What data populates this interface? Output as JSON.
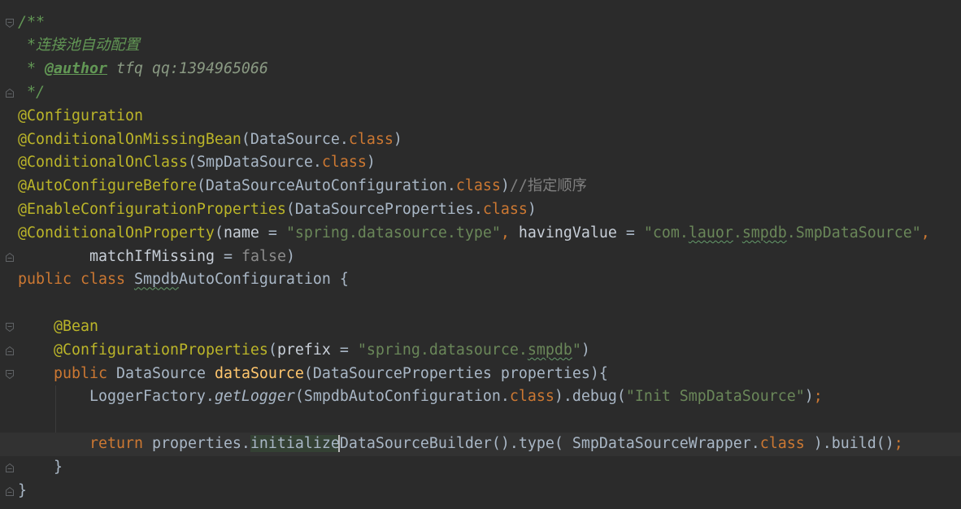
{
  "theme": {
    "background": "#2b2b2b",
    "text": "#a9b7c6",
    "keyword": "#cc7832",
    "annotation": "#bbb529",
    "string": "#6a8759",
    "doc_comment": "#629755",
    "doc_tag_value": "#8a9a83",
    "line_comment": "#808080",
    "named_param": "#c8cfd8",
    "method_declaration": "#ffc66d",
    "muted": "#8c8c8c",
    "typo_underline": "#659c6b",
    "current_line": "#323232",
    "usage_highlight": "#344134",
    "caret": "#bbbbbb",
    "gutter_icon": "#606366"
  },
  "editor": {
    "lines": [
      {
        "fold_icon": "fold-start-icon",
        "tokens": [
          {
            "t": "/**",
            "k": "doc"
          }
        ]
      },
      {
        "tokens": [
          {
            "t": " *连接池自动配置",
            "k": "doc"
          }
        ]
      },
      {
        "tokens": [
          {
            "t": " * ",
            "k": "doc"
          },
          {
            "t": "@author",
            "k": "doctag"
          },
          {
            "t": " tfq qq:1394965066",
            "k": "docval"
          }
        ]
      },
      {
        "fold_icon": "fold-end-icon",
        "tokens": [
          {
            "t": " */",
            "k": "doc"
          }
        ]
      },
      {
        "tokens": [
          {
            "t": "@Configuration",
            "k": "ann"
          }
        ]
      },
      {
        "tokens": [
          {
            "t": "@ConditionalOnMissingBean",
            "k": "ann"
          },
          {
            "t": "(DataSource.",
            "k": "plain"
          },
          {
            "t": "class",
            "k": "kw"
          },
          {
            "t": ")",
            "k": "plain"
          }
        ]
      },
      {
        "tokens": [
          {
            "t": "@ConditionalOnClass",
            "k": "ann"
          },
          {
            "t": "(SmpDataSource.",
            "k": "plain"
          },
          {
            "t": "class",
            "k": "kw"
          },
          {
            "t": ")",
            "k": "plain"
          }
        ]
      },
      {
        "tokens": [
          {
            "t": "@AutoConfigureBefore",
            "k": "ann"
          },
          {
            "t": "(DataSourceAutoConfiguration.",
            "k": "plain"
          },
          {
            "t": "class",
            "k": "kw"
          },
          {
            "t": ")",
            "k": "plain"
          },
          {
            "t": "//指定顺序",
            "k": "cmt"
          }
        ]
      },
      {
        "tokens": [
          {
            "t": "@EnableConfigurationProperties",
            "k": "ann"
          },
          {
            "t": "(DataSourceProperties.",
            "k": "plain"
          },
          {
            "t": "class",
            "k": "kw"
          },
          {
            "t": ")",
            "k": "plain"
          }
        ]
      },
      {
        "tokens": [
          {
            "t": "@ConditionalOnProperty",
            "k": "ann"
          },
          {
            "t": "(",
            "k": "plain"
          },
          {
            "t": "name",
            "k": "param"
          },
          {
            "t": " = ",
            "k": "plain"
          },
          {
            "t": "\"spring.datasource.type\"",
            "k": "str"
          },
          {
            "t": ",",
            "k": "kw"
          },
          {
            "t": " ",
            "k": "plain"
          },
          {
            "t": "havingValue",
            "k": "param"
          },
          {
            "t": " = ",
            "k": "plain"
          },
          {
            "t": "\"com.",
            "k": "str"
          },
          {
            "t": "lauor",
            "k": "typo-str"
          },
          {
            "t": ".",
            "k": "str"
          },
          {
            "t": "smpdb",
            "k": "typo-str"
          },
          {
            "t": ".SmpDataSource\"",
            "k": "str"
          },
          {
            "t": ",",
            "k": "kw"
          }
        ]
      },
      {
        "fold_icon": "fold-end-icon",
        "tokens": [
          {
            "t": "        ",
            "k": "plain"
          },
          {
            "t": "matchIfMissing",
            "k": "param"
          },
          {
            "t": " = ",
            "k": "plain"
          },
          {
            "t": "false",
            "k": "gray"
          },
          {
            "t": ")",
            "k": "plain"
          }
        ]
      },
      {
        "tokens": [
          {
            "t": "public",
            "k": "kw"
          },
          {
            "t": " ",
            "k": "plain"
          },
          {
            "t": "class",
            "k": "kw"
          },
          {
            "t": " ",
            "k": "plain"
          },
          {
            "t": "Smpdb",
            "k": "typo"
          },
          {
            "t": "AutoConfiguration {",
            "k": "plain"
          }
        ]
      },
      {
        "tokens": []
      },
      {
        "fold_icon": "fold-start-icon",
        "tokens": [
          {
            "t": "    ",
            "k": "plain"
          },
          {
            "t": "@Bean",
            "k": "ann"
          }
        ]
      },
      {
        "fold_icon": "fold-end-icon",
        "tokens": [
          {
            "t": "    ",
            "k": "plain"
          },
          {
            "t": "@ConfigurationProperties",
            "k": "ann"
          },
          {
            "t": "(",
            "k": "plain"
          },
          {
            "t": "prefix",
            "k": "param"
          },
          {
            "t": " = ",
            "k": "plain"
          },
          {
            "t": "\"spring.datasource.",
            "k": "str"
          },
          {
            "t": "smpdb",
            "k": "typo-str"
          },
          {
            "t": "\"",
            "k": "str"
          },
          {
            "t": ")",
            "k": "plain"
          }
        ]
      },
      {
        "fold_icon": "fold-start-icon",
        "tokens": [
          {
            "t": "    ",
            "k": "plain"
          },
          {
            "t": "public",
            "k": "kw"
          },
          {
            "t": " DataSource ",
            "k": "plain"
          },
          {
            "t": "dataSource",
            "k": "method"
          },
          {
            "t": "(DataSourceProperties properties){",
            "k": "plain"
          }
        ]
      },
      {
        "tokens": [
          {
            "t": "        LoggerFactory.",
            "k": "plain"
          },
          {
            "t": "getLogger",
            "k": "static"
          },
          {
            "t": "(SmpdbAutoConfiguration.",
            "k": "plain"
          },
          {
            "t": "class",
            "k": "kw"
          },
          {
            "t": ").debug(",
            "k": "plain"
          },
          {
            "t": "\"Init SmpDataSource\"",
            "k": "str"
          },
          {
            "t": ")",
            "k": "plain"
          },
          {
            "t": ";",
            "k": "kw"
          }
        ]
      },
      {
        "tokens": []
      },
      {
        "current": true,
        "tokens": [
          {
            "t": "        ",
            "k": "plain"
          },
          {
            "t": "return",
            "k": "kw"
          },
          {
            "t": " properties.",
            "k": "plain"
          },
          {
            "t": "initialize",
            "k": "usage"
          },
          {
            "t": "DataSourceBuilder",
            "k": "plain"
          },
          {
            "t": "().type( SmpDataSourceWrapper.",
            "k": "plain"
          },
          {
            "t": "class",
            "k": "kw"
          },
          {
            "t": " ).build()",
            "k": "plain"
          },
          {
            "t": ";",
            "k": "kw"
          }
        ]
      },
      {
        "fold_icon": "fold-end-icon",
        "tokens": [
          {
            "t": "    }",
            "k": "plain"
          }
        ]
      },
      {
        "fold_icon": "fold-end-icon",
        "tokens": [
          {
            "t": "}",
            "k": "plain"
          }
        ]
      }
    ]
  }
}
